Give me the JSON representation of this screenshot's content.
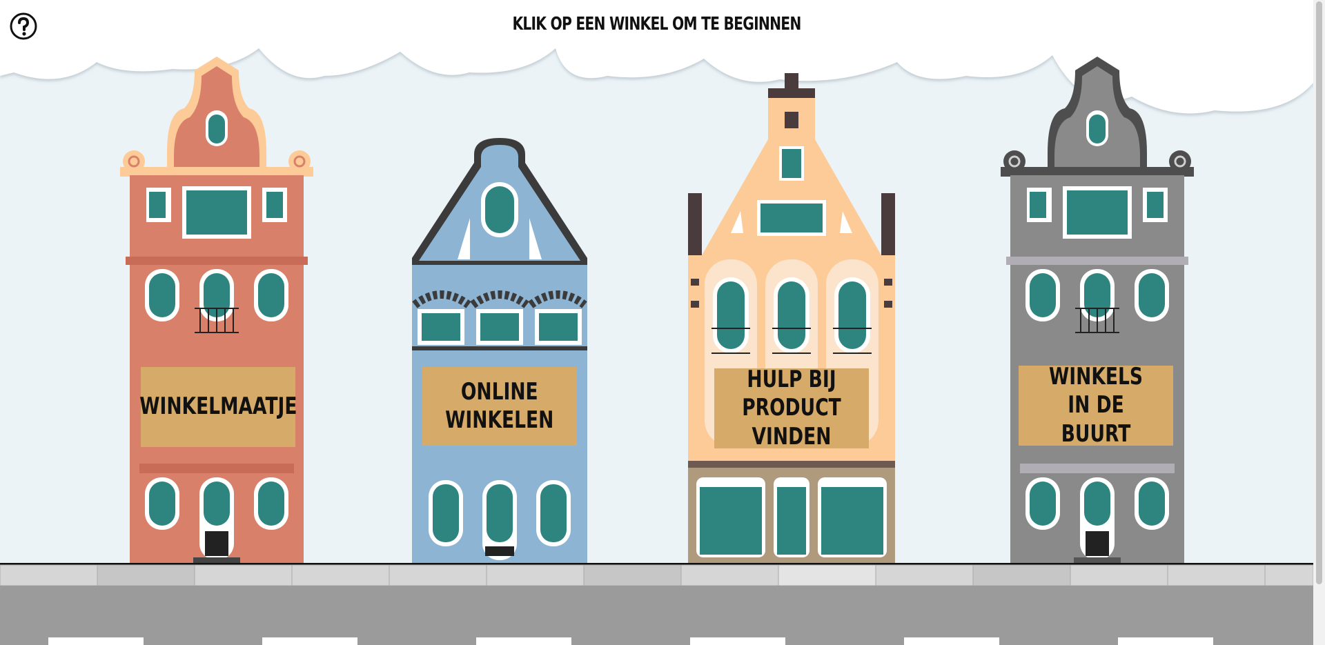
{
  "header": {
    "title": "KLIK OP EEN WINKEL OM TE BEGINNEN",
    "help_icon": "question-circle-icon"
  },
  "shops": [
    {
      "label": "WINKELMAATJE",
      "color": "#d9806a"
    },
    {
      "label": "ONLINE\nWINKELEN",
      "color": "#8eb4d4"
    },
    {
      "label": "HULP BIJ\nPRODUCT VINDEN",
      "color": "#fccb98"
    },
    {
      "label": "WINKELS IN DE\nBUURT",
      "color": "#8a8a8a"
    }
  ],
  "colors": {
    "sky": "#ebf3f7",
    "sign": "#d6aa68",
    "window": "#2e8580",
    "road": "#9b9b9b",
    "sidewalk": "#d6d6d6"
  }
}
